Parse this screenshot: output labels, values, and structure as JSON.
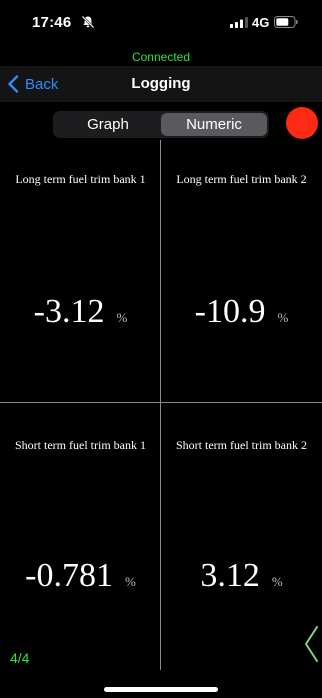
{
  "status": {
    "time": "17:46",
    "network": "4G"
  },
  "connection": {
    "text": "Connected"
  },
  "nav": {
    "back_label": "Back",
    "title": "Logging"
  },
  "tabs": {
    "graph": "Graph",
    "numeric": "Numeric",
    "selected": "numeric"
  },
  "record": {
    "color": "#ff2a14"
  },
  "cells": [
    {
      "label": "Long term fuel trim bank 1",
      "value": "-3.12",
      "unit": "%"
    },
    {
      "label": "Long term fuel trim bank 2",
      "value": "-10.9",
      "unit": "%"
    },
    {
      "label": "Short term fuel trim bank 1",
      "value": "-0.781",
      "unit": "%"
    },
    {
      "label": "Short term fuel trim bank 2",
      "value": "3.12",
      "unit": "%"
    }
  ],
  "pager": {
    "text": "4/4"
  },
  "colors": {
    "accent_green": "#2fe04a",
    "link_blue": "#2f8cff"
  }
}
